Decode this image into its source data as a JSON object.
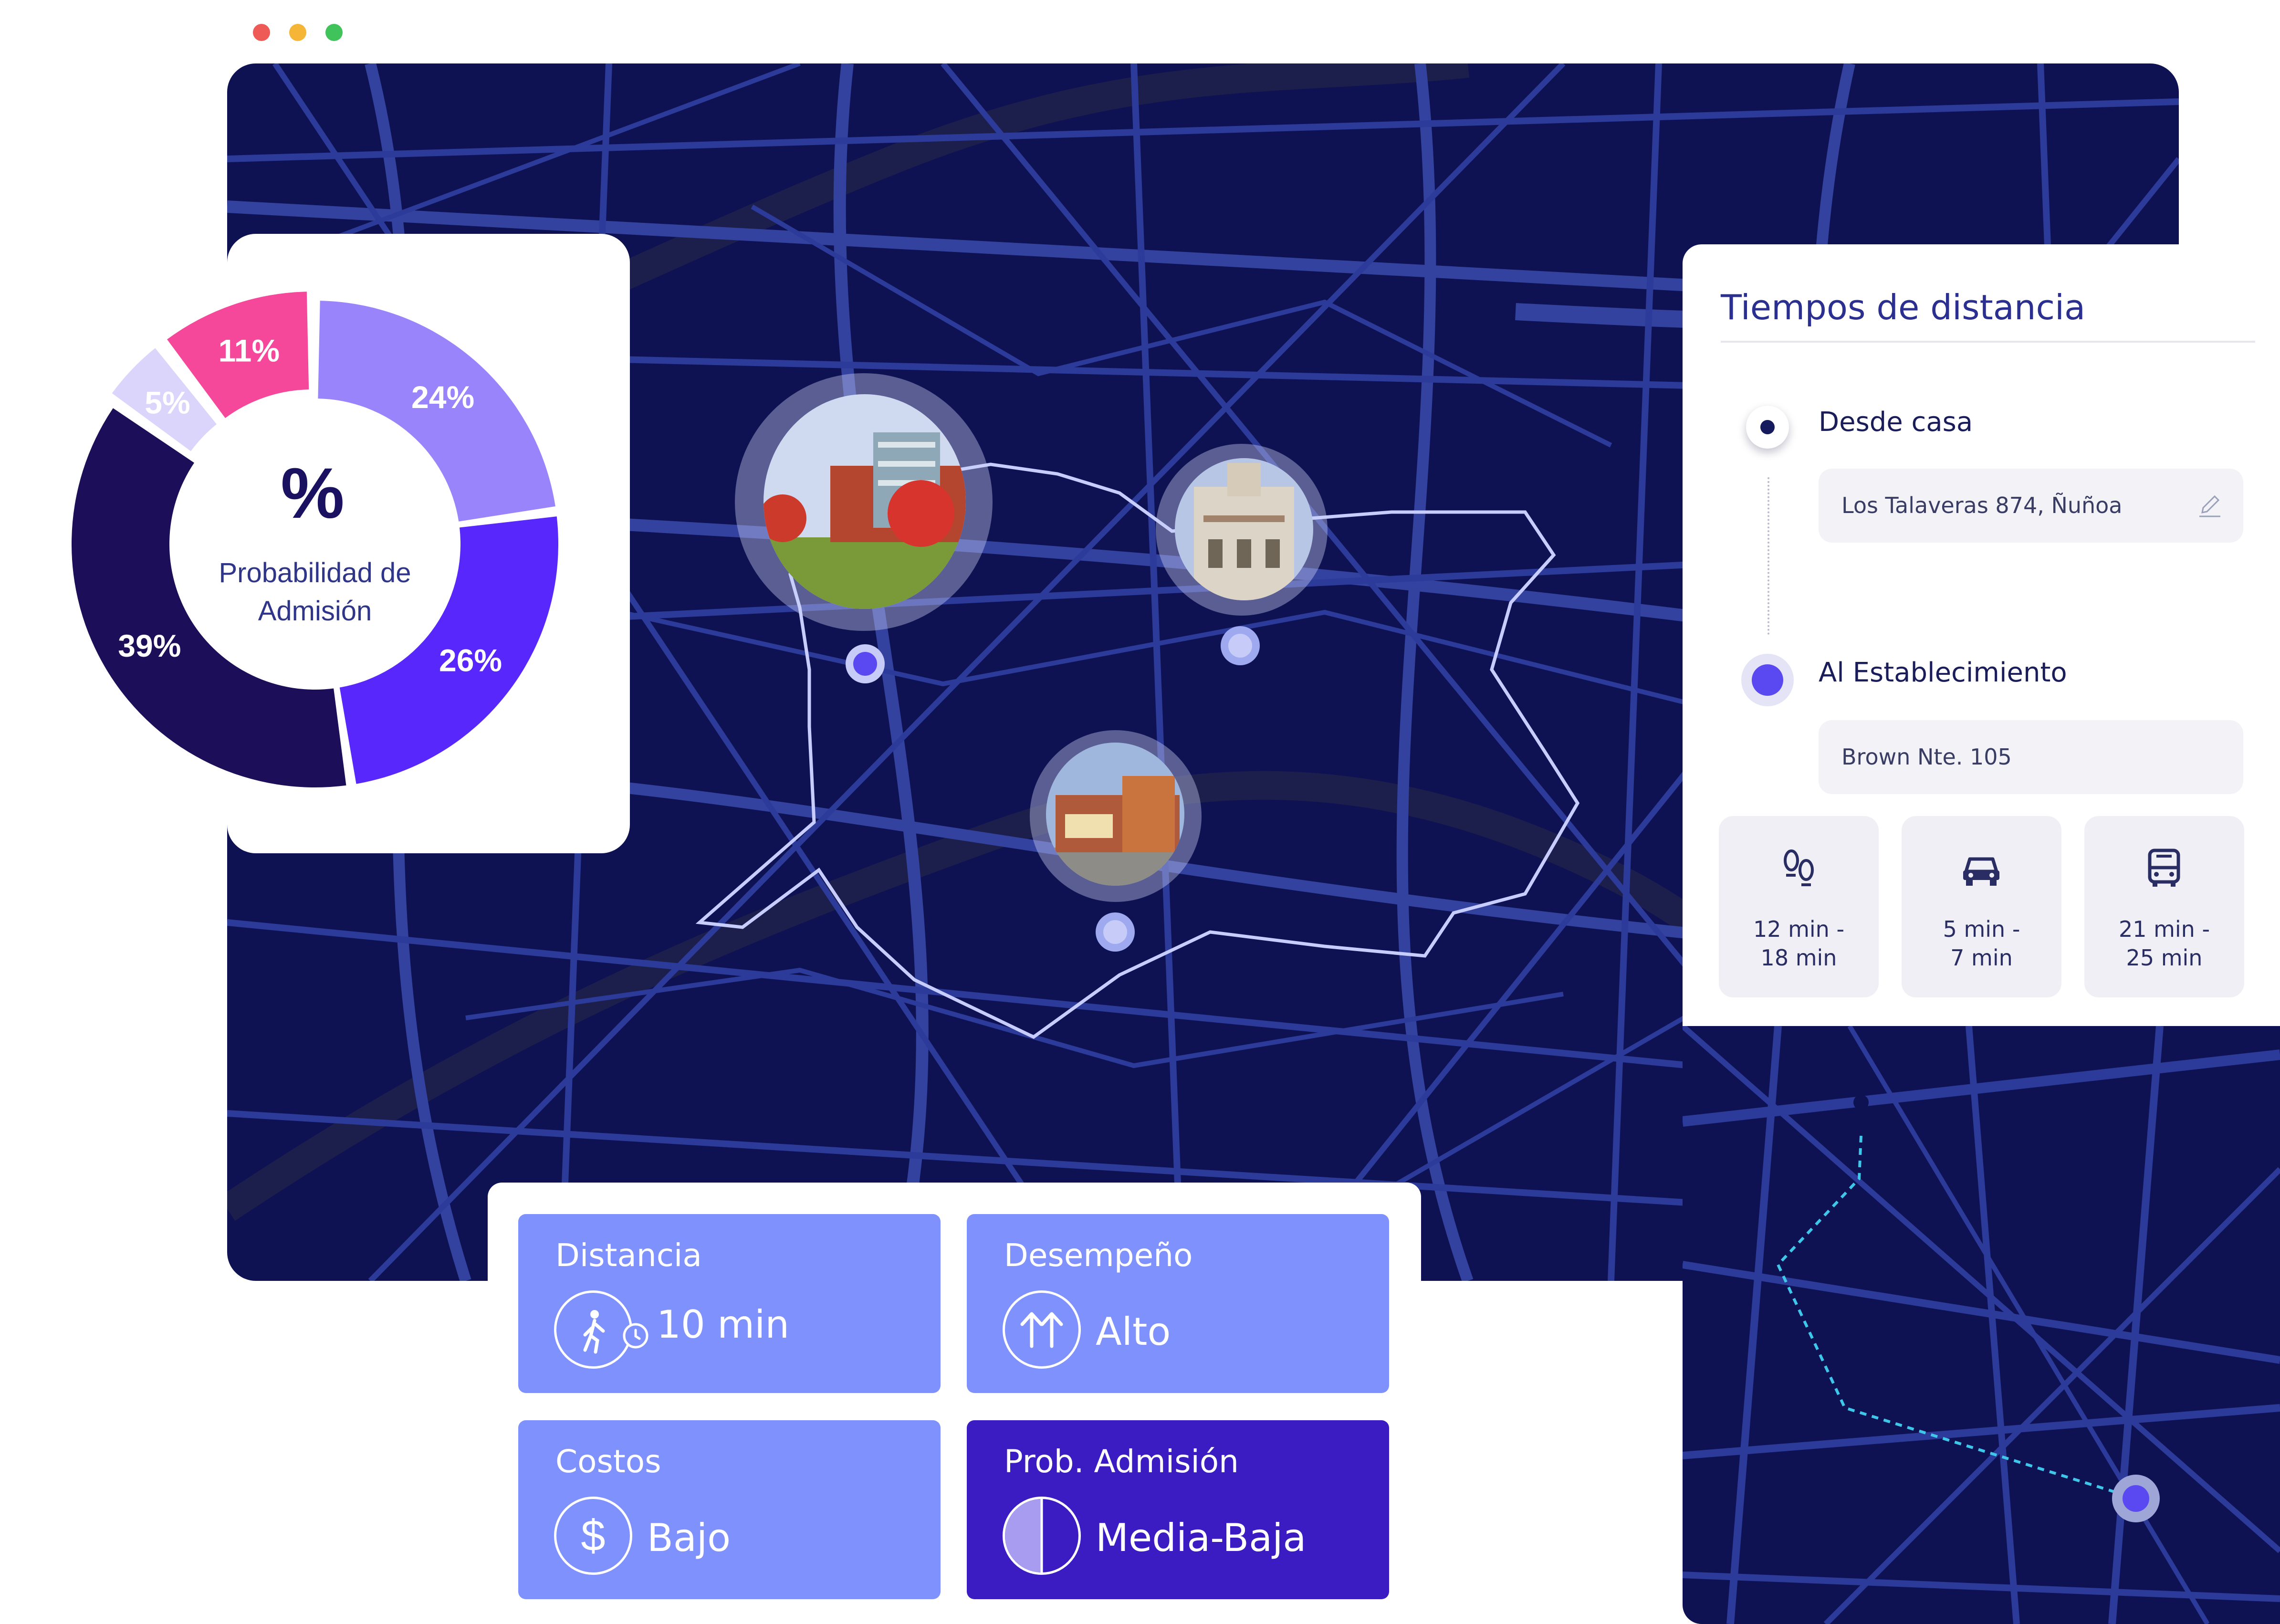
{
  "window": {
    "controls": [
      {
        "name": "close",
        "color": "#ee5b57"
      },
      {
        "name": "minimize",
        "color": "#f5b537"
      },
      {
        "name": "maximize",
        "color": "#3fc35a"
      }
    ]
  },
  "colors": {
    "map_background": "#0e1253",
    "roads": "#2c3a9a",
    "zone_fill": "#7080d6",
    "zone_border": "#c7cdff",
    "accent": "#5a49f0",
    "card_blue": "#7f91fd",
    "card_dark": "#3b1cc2"
  },
  "admission_chart": {
    "center_symbol": "%",
    "center_line1": "Probabilidad de",
    "center_line2": "Admisión"
  },
  "chart_data": {
    "type": "pie",
    "title": "",
    "slices": [
      {
        "label": "24%",
        "value": 24,
        "color": "#9a84fb"
      },
      {
        "label": "26%",
        "value": 26,
        "color": "#5827fb"
      },
      {
        "label": "39%",
        "value": 39,
        "color": "#1c0e58"
      },
      {
        "label": "5%",
        "value": 5,
        "color": "#dbd4fb"
      },
      {
        "label": "11%",
        "value": 11,
        "color": "#f5489a"
      }
    ],
    "legend": "none",
    "donut": true
  },
  "map": {
    "schools": [
      {
        "name": "school-photo-1",
        "marker_color": "#5a49f0"
      },
      {
        "name": "school-photo-2",
        "marker_color": "#c6ccf7"
      },
      {
        "name": "school-photo-3",
        "marker_color": "#c6ccf7"
      }
    ]
  },
  "travel_times": {
    "title": "Tiempos de distancia",
    "origin": {
      "label": "Desde casa",
      "address": "Los Talaveras 874, Ñuñoa"
    },
    "destination": {
      "label": "Al Establecimiento",
      "address": "Brown Nte. 105"
    },
    "modes": [
      {
        "icon": "footsteps-icon",
        "line1": "12 min  -",
        "line2": "18 min"
      },
      {
        "icon": "car-icon",
        "line1": "5 min  -",
        "line2": "7 min"
      },
      {
        "icon": "bus-icon",
        "line1": "21 min  -",
        "line2": "25 min"
      }
    ]
  },
  "stats": {
    "distance": {
      "title": "Distancia",
      "value": "10 min",
      "icon": "walk-clock-icon"
    },
    "performance": {
      "title": "Desempeño",
      "value": "Alto",
      "icon": "up-arrows-icon"
    },
    "costs": {
      "title": "Costos",
      "value": "Bajo",
      "icon": "dollar-icon"
    },
    "admission": {
      "title": "Prob. Admisión",
      "value": "Media-Baja",
      "icon": "half-circle-icon"
    }
  }
}
